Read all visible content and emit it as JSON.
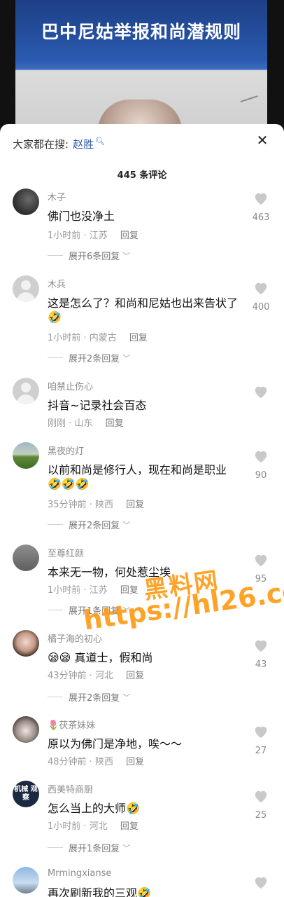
{
  "video": {
    "title": "巴中尼姑举报和尚潜规则"
  },
  "search": {
    "prefix": "大家都在搜:",
    "term": "赵胜"
  },
  "comment_count": "445 条评论",
  "comments": [
    {
      "user": "木子",
      "text": "佛门也没净土",
      "time": "1小时前",
      "location": "江苏",
      "reply": "回复",
      "expand": "展开6条回复",
      "likes": "463"
    },
    {
      "user": "木兵",
      "text": "这是怎么了？和尚和尼姑也出来告状了",
      "time": "1小时前",
      "location": "内蒙古",
      "reply": "回复",
      "expand": "展开2条回复",
      "likes": "400",
      "emoji": "🤣"
    },
    {
      "user": "咱禁止伤心",
      "text": "抖音~记录社会百态",
      "time": "刚刚",
      "location": "山东",
      "reply": "回复",
      "likes": ""
    },
    {
      "user": "黑夜的灯",
      "text": "以前和尚是修行人，现在和尚是职业",
      "time": "35分钟前",
      "location": "陕西",
      "reply": "回复",
      "expand": "展开2条回复",
      "likes": "90",
      "emoji": "🤣🤣🤣"
    },
    {
      "user": "至尊红颜",
      "text": "本来无一物，何处惹尘埃",
      "time": "1小时前",
      "location": "江苏",
      "reply": "回复",
      "expand": "展开1条回复",
      "likes": "95"
    },
    {
      "user": "橘子海的初心",
      "text": "真道士，假和尚",
      "time": "43分钟前",
      "location": "河北",
      "reply": "回复",
      "expand": "展开2条回复",
      "likes": "43",
      "emoji": "😪😪"
    },
    {
      "user": "茯茶妹妹",
      "text": "原以为佛门是净地，唉～～",
      "time": "48分钟前",
      "location": "陕西",
      "reply": "回复",
      "likes": "27",
      "flower": "🌷"
    },
    {
      "user": "西美特商厨",
      "text": "怎么当上的大师",
      "time": "1小时前",
      "location": "河北",
      "reply": "回复",
      "expand": "展开1条回复",
      "likes": "25",
      "emoji": "🤣",
      "avatar_text": "机械 观察"
    },
    {
      "user": "Mrmingxianse",
      "text": "再次刷新我的三观",
      "emoji": "🤣"
    }
  ],
  "watermark": {
    "line1": "黑料网",
    "line2": "https://hl26.co"
  },
  "icons": {
    "like": "heart-icon",
    "close": "close-icon",
    "search": "search-icon",
    "chevron": "chevron-down-icon"
  },
  "colors": {
    "accent": "#2b5aa5",
    "watermark": "#ff960a"
  }
}
